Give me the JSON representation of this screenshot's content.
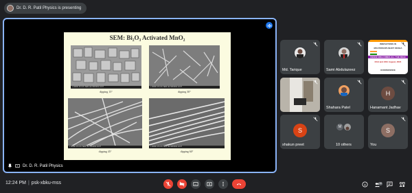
{
  "top_bar": {
    "presenting_text": "Dr. D. R. Patil Physics is presenting"
  },
  "slide": {
    "title": "SEM: Bi₂O₃ Activated MnO₂",
    "scale_text": "x 40000  15.0 kV  SEM  LEI  5/8/2019 14:07",
    "images": [
      {
        "caption": "dipping 15°",
        "scale": "100nm"
      },
      {
        "caption": "dipping 30°",
        "scale": "100nm"
      },
      {
        "caption": "dipping 45°",
        "scale": "100nm"
      },
      {
        "caption": "dipping 60°",
        "scale": "100nm"
      }
    ]
  },
  "presenter": {
    "name": "Dr. D. R. Patil Physics"
  },
  "participants": [
    {
      "name": "Md. Tarique",
      "avatar_color": "#e9e9e9"
    },
    {
      "name": "Sami Abdulazeez",
      "avatar_color": "#d7d7d7"
    },
    {
      "name": "",
      "poster_lines": [
        "INNOVATIONS IN",
        "MULTIDISCIPLINARY RESEA",
        "RENCE WELCOMES ALL THE DELE",
        "23rd and 24th August, 2021",
        "ICONFERENCE"
      ]
    },
    {
      "name": "",
      "avatar_color": "#b9b4aa"
    },
    {
      "name": "Shahara Patel",
      "avatar_color": "#f0a060"
    },
    {
      "name": "Hanamant Jadhav",
      "letter": "H",
      "avatar_color": "#6d4c41"
    },
    {
      "name": "shakun preet",
      "letter": "S",
      "avatar_color": "#d84315"
    },
    {
      "name": "10 others",
      "letter": "M",
      "avatar_color": "#5f6368"
    },
    {
      "name": "You",
      "letter": "S",
      "avatar_color": "#8d6e63"
    }
  ],
  "bottom_bar": {
    "time": "12:24 PM",
    "separator": "|",
    "meeting_code": "psk-xbku-mss",
    "people_count": "10"
  },
  "colors": {
    "accent": "#8ab4f8",
    "danger": "#ea4335",
    "tile": "#3c4043"
  }
}
